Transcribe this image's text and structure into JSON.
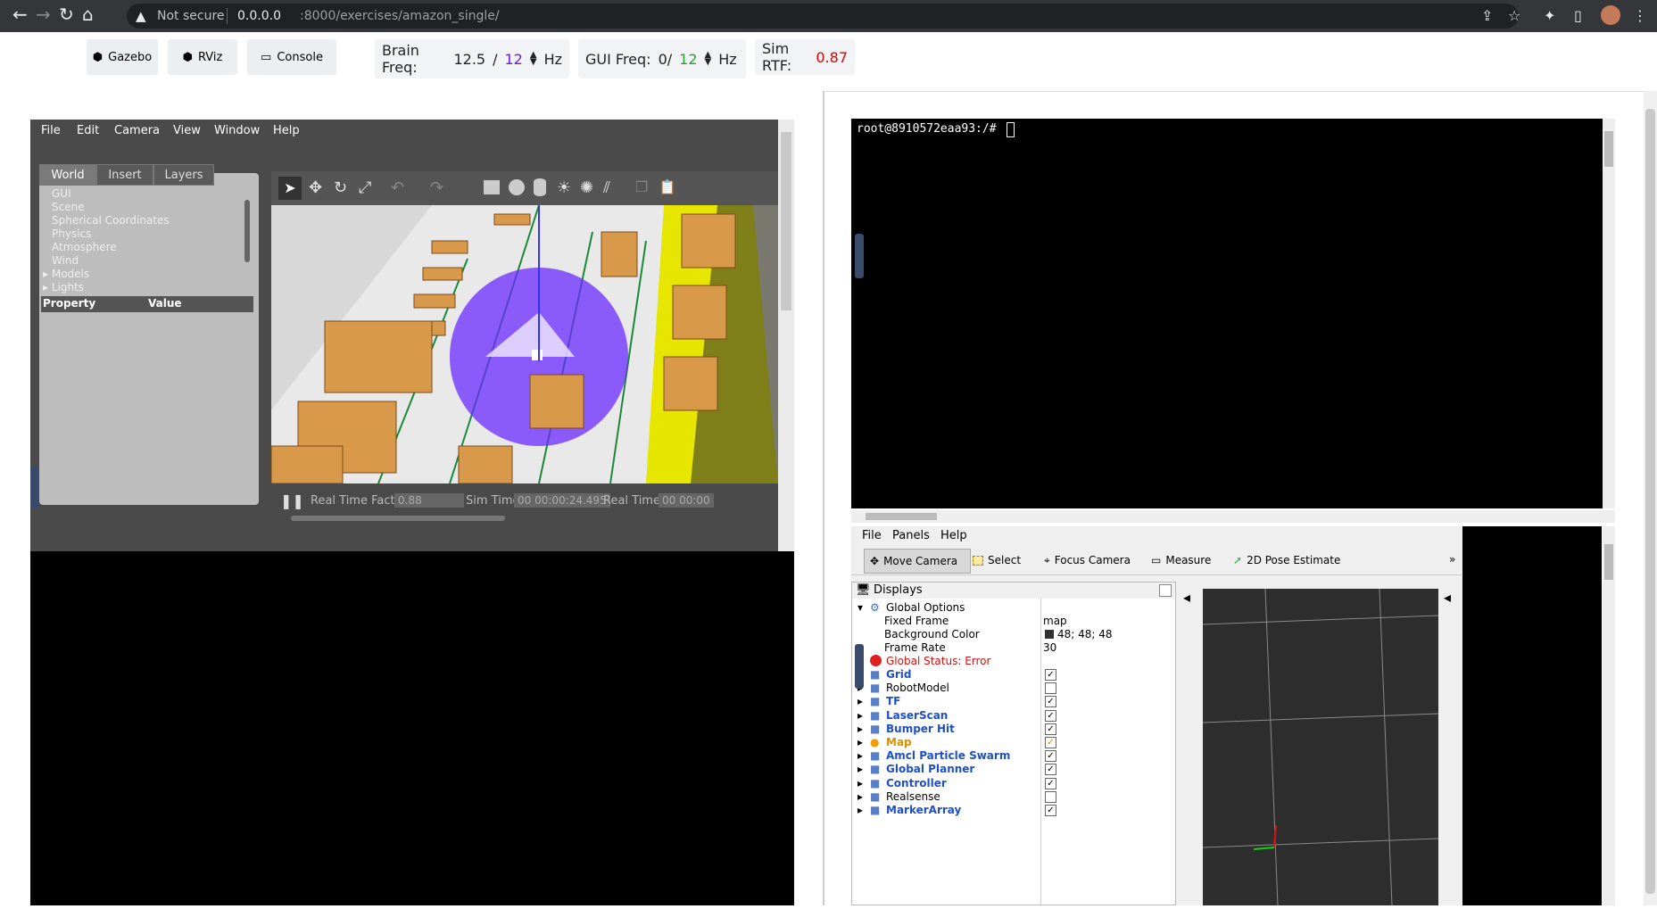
{
  "browser": {
    "warning": "Not secure",
    "url_host": "0.0.0.0",
    "url_path": ":8000/exercises/amazon_single/"
  },
  "toolbar": {
    "gazebo_label": "Gazebo",
    "rviz_label": "RViz",
    "console_label": "Console",
    "brain_freq_label": "Brain Freq:",
    "brain_freq_value": "12.5",
    "brain_freq_sep": "/",
    "brain_freq_target": "12",
    "brain_freq_unit": "Hz",
    "gui_freq_label": "GUI Freq:",
    "gui_freq_value": "0/",
    "gui_freq_target": "12",
    "gui_freq_unit": "Hz",
    "sim_rtf_label": "Sim RTF:",
    "sim_rtf_value": "0.87",
    "colors": {
      "target": "#6a1de0",
      "gui_target": "#2e9e2e",
      "rtf": "#e00000"
    }
  },
  "gazebo": {
    "menu": [
      "File",
      "Edit",
      "Camera",
      "View",
      "Window",
      "Help"
    ],
    "tabs": [
      "World",
      "Insert",
      "Layers"
    ],
    "tree": [
      "GUI",
      "Scene",
      "Spherical Coordinates",
      "Physics",
      "Atmosphere",
      "Wind",
      "Models",
      "Lights"
    ],
    "prop_header": "Property",
    "value_header": "Value",
    "rtf_label": "Real Time Factor:",
    "rtf_value": "0.88",
    "sim_time_label": "Sim Time:",
    "sim_time_value": "00 00:00:24.495",
    "real_time_label": "Real Time:",
    "real_time_value": "00 00:00"
  },
  "terminal": {
    "prompt": "root@8910572eaa93:/# "
  },
  "rviz": {
    "menu": [
      "File",
      "Panels",
      "Help"
    ],
    "tools": [
      "Move Camera",
      "Select",
      "Focus Camera",
      "Measure",
      "2D Pose Estimate"
    ],
    "displays_title": "Displays",
    "global_options": "Global Options",
    "fixed_frame_label": "Fixed Frame",
    "fixed_frame_value": "map",
    "bg_color_label": "Background Color",
    "bg_color_value": "48; 48; 48",
    "frame_rate_label": "Frame Rate",
    "frame_rate_value": "30",
    "global_status": "Global Status: Error",
    "items": [
      {
        "label": "Grid",
        "checked": true,
        "style": "blue"
      },
      {
        "label": "RobotModel",
        "checked": false,
        "style": "plain"
      },
      {
        "label": "TF",
        "checked": true,
        "style": "blue"
      },
      {
        "label": "LaserScan",
        "checked": true,
        "style": "blue"
      },
      {
        "label": "Bumper Hit",
        "checked": true,
        "style": "blue"
      },
      {
        "label": "Map",
        "checked": true,
        "style": "warn"
      },
      {
        "label": "Amcl Particle Swarm",
        "checked": true,
        "style": "blue"
      },
      {
        "label": "Global Planner",
        "checked": true,
        "style": "blue"
      },
      {
        "label": "Controller",
        "checked": true,
        "style": "blue"
      },
      {
        "label": "Realsense",
        "checked": false,
        "style": "plain"
      },
      {
        "label": "MarkerArray",
        "checked": true,
        "style": "blue"
      }
    ]
  }
}
